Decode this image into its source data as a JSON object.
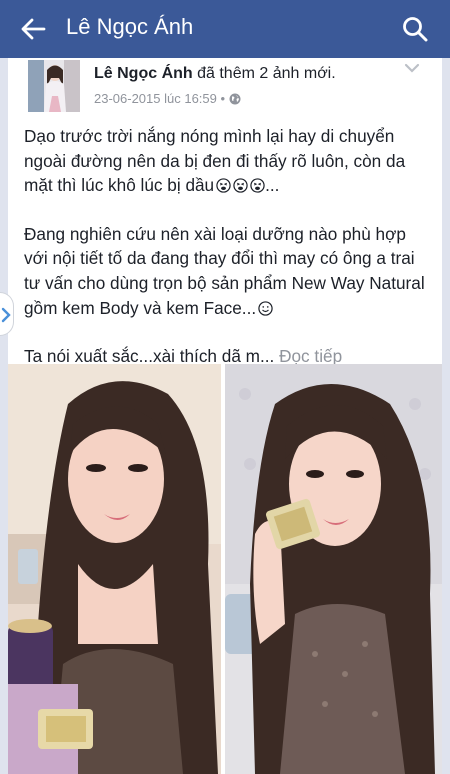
{
  "header": {
    "title": "Lê Ngọc Ánh",
    "bg_color": "#3b5998"
  },
  "post": {
    "author": "Lê Ngọc Ánh",
    "action": " đã thêm 2 ảnh mới.",
    "timestamp": "23-06-2015 lúc 16:59",
    "privacy_separator": "•",
    "paragraph1": "Dạo trước trời nắng nóng mình lại hay di chuyển ngoài đường nên da bị đen đi thấy rõ luôn, còn da mặt thì lúc khô lúc bị dầu",
    "paragraph1_tail": "...",
    "paragraph2": "Đang nghiên cứu nên xài loại dưỡng nào phù hợp với nội tiết tố da đang thay đổi thì may có ông a trai tư vấn cho dùng trọn bộ sản phẩm New Way Natural gồm kem Body và kem Face...",
    "paragraph3": "Ta nói xuất sắc...xài thích dã m... ",
    "see_more": "Đọc tiếp"
  },
  "colors": {
    "text": "#1d2129",
    "muted": "#90949c",
    "page_bg": "#dfe3ee"
  },
  "icons": [
    "arrow-back-icon",
    "search-icon",
    "chevron-down-icon",
    "globe-icon",
    "tired-face-emoji",
    "smile-emoji",
    "chevron-right-icon"
  ]
}
